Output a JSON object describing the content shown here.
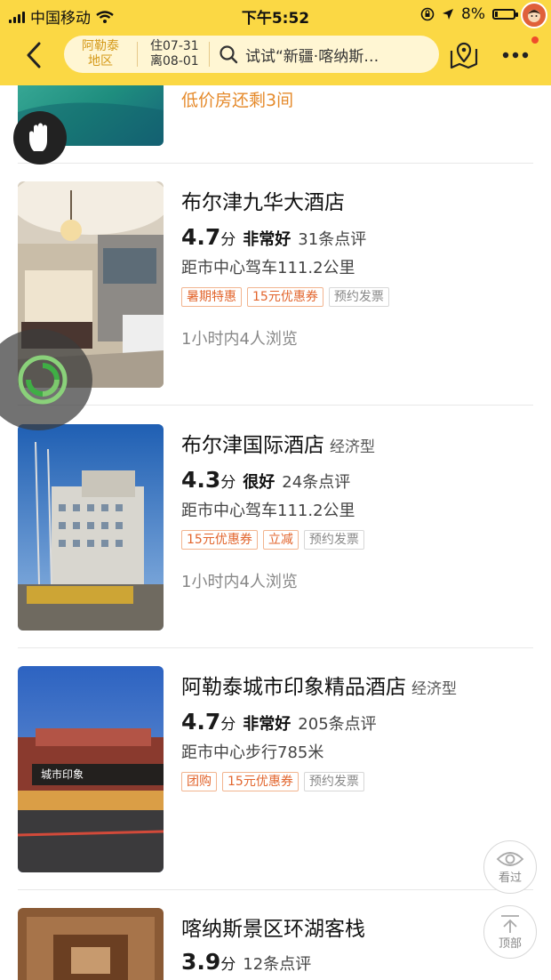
{
  "status": {
    "carrier": "中国移动",
    "time": "下午5:52",
    "battery": "8%"
  },
  "header": {
    "location": [
      "阿勒泰",
      "地区"
    ],
    "checkin": "住07-31",
    "checkout": "离08-01",
    "search_text": "试试“新疆·喀纳斯…"
  },
  "hotels": [
    {
      "low_room_text": "低价房还剩3间"
    },
    {
      "name": "布尔津九华大酒店",
      "type": "",
      "score": "4.7",
      "score_unit": "分",
      "rating": "非常好",
      "reviews": "31条点评",
      "distance": "距市中心驾车111.2公里",
      "tags": [
        "暑期特惠",
        "15元优惠券",
        "预约发票"
      ],
      "views": "1小时内4人浏览"
    },
    {
      "name": "布尔津国际酒店",
      "type": "经济型",
      "score": "4.3",
      "score_unit": "分",
      "rating": "很好",
      "reviews": "24条点评",
      "distance": "距市中心驾车111.2公里",
      "tags": [
        "15元优惠券",
        "立减",
        "预约发票"
      ],
      "views": "1小时内4人浏览"
    },
    {
      "name": "阿勒泰城市印象精品酒店",
      "type": "经济型",
      "score": "4.7",
      "score_unit": "分",
      "rating": "非常好",
      "reviews": "205条点评",
      "distance": "距市中心步行785米",
      "tags": [
        "团购",
        "15元优惠券",
        "预约发票"
      ],
      "views": ""
    },
    {
      "name": "喀纳斯景区环湖客栈",
      "type": "",
      "score": "3.9",
      "score_unit": "分",
      "rating": "",
      "reviews": "12条点评"
    }
  ],
  "floating": {
    "viewed_label": "看过",
    "top_label": "顶部"
  }
}
